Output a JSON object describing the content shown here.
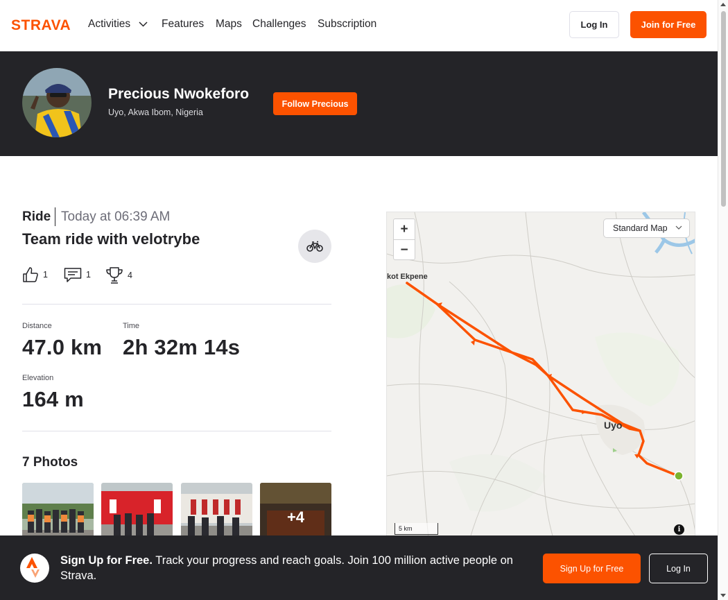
{
  "nav": {
    "brand": "STRAVA",
    "items": [
      {
        "label": "Activities"
      },
      {
        "label": "Features"
      },
      {
        "label": "Maps"
      },
      {
        "label": "Challenges"
      },
      {
        "label": "Subscription"
      }
    ],
    "login_label": "Log In",
    "join_label": "Join for Free"
  },
  "athlete": {
    "name": "Precious Nwokeforo",
    "location": "Uyo, Akwa Ibom, Nigeria",
    "follow_label": "Follow Precious"
  },
  "activity": {
    "type": "Ride",
    "time": "Today at 06:39 AM",
    "title": "Team ride with velotrybe",
    "sport_icon": "bike-icon",
    "kudos_count": "1",
    "comments_count": "1",
    "achievements_count": "4"
  },
  "stats": {
    "distance_label": "Distance",
    "distance_value": "47.0 km",
    "time_label": "Time",
    "time_value": "2h 32m 14s",
    "elevation_label": "Elevation",
    "elevation_value": "164 m"
  },
  "photos": {
    "title": "7 Photos",
    "more_label": "+4"
  },
  "map": {
    "map_type": "Standard Map",
    "zoom_in": "+",
    "zoom_out": "−",
    "scale_label": "5 km",
    "info": "i",
    "places": {
      "ikot_ekpene": "kot Ekpene",
      "uyo": "Uyo"
    },
    "route_color": "#fc5200",
    "end_marker_color": "#7cb32f"
  },
  "banner": {
    "headline": "Sign Up for Free.",
    "text": "Track your progress and reach goals. Join 100 million active people on Strava.",
    "signup_label": "Sign Up for Free",
    "login_label": "Log In"
  },
  "colors": {
    "brand": "#fc5200",
    "dark": "#242428"
  }
}
